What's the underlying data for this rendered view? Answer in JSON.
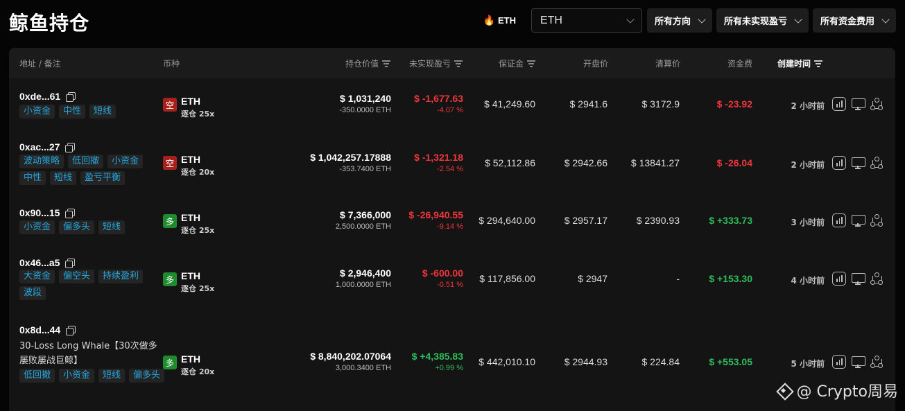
{
  "title": "鲸鱼持仓",
  "filters": {
    "hot_symbol": "ETH",
    "symbol_select": "ETH",
    "direction": "所有方向",
    "pnl": "所有未实现盈亏",
    "funding": "所有资金费用"
  },
  "columns": {
    "address": "地址 / 备注",
    "coin": "币种",
    "position_value": "持仓价值",
    "unrealized_pnl": "未实现盈亏",
    "margin": "保证金",
    "entry_price": "开盘价",
    "liq_price": "清算价",
    "funding_fee": "资金费",
    "created": "创建时间"
  },
  "rows": [
    {
      "address": "0xde...61",
      "note": "",
      "tags": [
        "小资金",
        "中性",
        "短线"
      ],
      "side": "空",
      "side_type": "short",
      "coin": "ETH",
      "leverage": "逐仓 25x",
      "value": "$ 1,031,240",
      "size": "-350.0000 ETH",
      "pnl": "$ -1,677.63",
      "pnl_pct": "-4.07 %",
      "pnl_dir": "red",
      "margin": "$ 41,249.60",
      "entry": "$ 2941.6",
      "liq": "$ 3172.9",
      "funding": "$ -23.92",
      "funding_dir": "red",
      "time": "2 小时前"
    },
    {
      "address": "0xac...27",
      "note": "",
      "tags": [
        "波动策略",
        "低回撤",
        "小资金",
        "中性",
        "短线",
        "盈亏平衡"
      ],
      "side": "空",
      "side_type": "short",
      "coin": "ETH",
      "leverage": "逐仓 20x",
      "value": "$ 1,042,257.17888",
      "size": "-353.7400 ETH",
      "pnl": "$ -1,321.18",
      "pnl_pct": "-2.54 %",
      "pnl_dir": "red",
      "margin": "$ 52,112.86",
      "entry": "$ 2942.66",
      "liq": "$ 13841.27",
      "funding": "$ -26.04",
      "funding_dir": "red",
      "time": "2 小时前"
    },
    {
      "address": "0x90...15",
      "note": "",
      "tags": [
        "小资金",
        "偏多头",
        "短线"
      ],
      "side": "多",
      "side_type": "long",
      "coin": "ETH",
      "leverage": "逐仓 25x",
      "value": "$ 7,366,000",
      "size": "2,500.0000 ETH",
      "pnl": "$ -26,940.55",
      "pnl_pct": "-9.14 %",
      "pnl_dir": "red",
      "margin": "$ 294,640.00",
      "entry": "$ 2957.17",
      "liq": "$ 2390.93",
      "funding": "$ +333.73",
      "funding_dir": "green",
      "time": "3 小时前"
    },
    {
      "address": "0x46...a5",
      "note": "",
      "tags": [
        "大资金",
        "偏空头",
        "持续盈利",
        "波段"
      ],
      "side": "多",
      "side_type": "long",
      "coin": "ETH",
      "leverage": "逐仓 25x",
      "value": "$ 2,946,400",
      "size": "1,000.0000 ETH",
      "pnl": "$ -600.00",
      "pnl_pct": "-0.51 %",
      "pnl_dir": "red",
      "margin": "$ 117,856.00",
      "entry": "$ 2947",
      "liq": "-",
      "funding": "$ +153.30",
      "funding_dir": "green",
      "time": "4 小时前"
    },
    {
      "address": "0x8d...44",
      "note": "30-Loss Long Whale【30次做多屡败屡战巨鲸】",
      "tags": [
        "低回撤",
        "小资金",
        "短线",
        "偏多头"
      ],
      "side": "多",
      "side_type": "long",
      "coin": "ETH",
      "leverage": "逐仓 20x",
      "value": "$ 8,840,202.07064",
      "size": "3,000.3400 ETH",
      "pnl": "$ +4,385.83",
      "pnl_pct": "+0.99 %",
      "pnl_dir": "green",
      "margin": "$ 442,010.10",
      "entry": "$ 2944.93",
      "liq": "$ 224.84",
      "funding": "$ +553.05",
      "funding_dir": "green",
      "time": "5 小时前"
    }
  ],
  "watermark": "@ Crypto周易"
}
